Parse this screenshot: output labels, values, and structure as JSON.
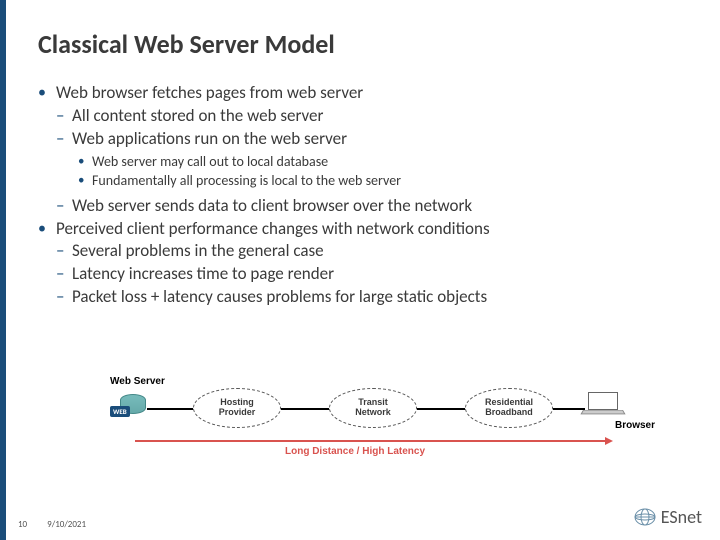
{
  "title": "Classical Web Server Model",
  "bullets": {
    "b1": "Web browser fetches pages from web server",
    "b1s1": "All content stored on the web server",
    "b1s2": "Web applications run on the web server",
    "b1ss1": "Web server may call out to local database",
    "b1ss2": "Fundamentally all processing is local to the web server",
    "b1s3": "Web server sends data to client browser over the network",
    "b2": "Perceived client performance changes with network conditions",
    "b2s1": "Several problems in the general case",
    "b2s2": "Latency increases time to page render",
    "b2s3": "Packet loss + latency causes problems for large static objects"
  },
  "diagram": {
    "web_server": "Web Server",
    "web_badge": "WEB",
    "hosting": "Hosting\nProvider",
    "transit": "Transit\nNetwork",
    "residential": "Residential\nBroadband",
    "browser": "Browser",
    "latency": "Long Distance / High Latency"
  },
  "footer": {
    "page": "10",
    "date": "9/10/2021"
  },
  "logo": {
    "text": "ESnet"
  }
}
